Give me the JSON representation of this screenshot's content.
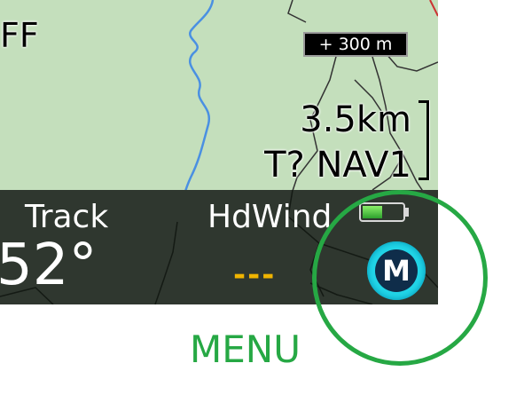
{
  "map": {
    "flight_mode": "FF",
    "altitude_offset": "+ 300 m",
    "distance": "3.5km",
    "target": "T? NAV1"
  },
  "infobar": {
    "track_label": "Track",
    "track_value": "52°",
    "hdwind_label": "HdWind",
    "hdwind_value": "---"
  },
  "battery": {
    "level": 0.5,
    "icon": "battery-icon"
  },
  "menu_button": {
    "glyph": "M",
    "icon": "menu-icon"
  },
  "caption": "MENU",
  "colors": {
    "map_bg": "#c4dfbc",
    "infobar_bg": "#2f372f",
    "hdwind_value": "#f0b400",
    "menu_button": "#22d6e8",
    "highlight": "#26a844"
  }
}
